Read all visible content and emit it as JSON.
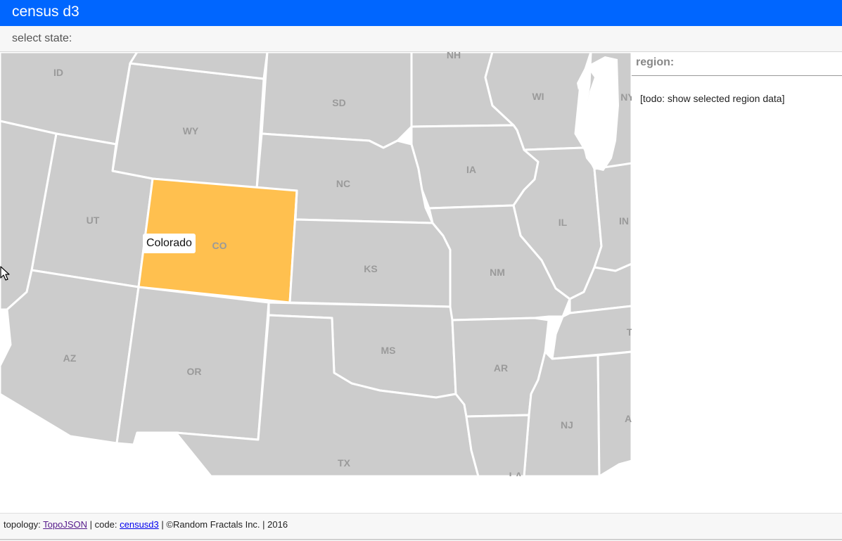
{
  "header": {
    "title": "census d3"
  },
  "toolbar": {
    "select_label": "select state:"
  },
  "map": {
    "selected_state": "CO",
    "selected_fill": "#ffc04f",
    "state_fill": "#cccccc",
    "tooltip": "Colorado",
    "state_labels": [
      "ID",
      "WY",
      "SD",
      "NH",
      "WI",
      "NY",
      "UT",
      "CO",
      "NC",
      "IA",
      "IL",
      "IN",
      "KS",
      "NM",
      "AZ",
      "OR",
      "MS",
      "AR",
      "T",
      "NJ",
      "A",
      "TX",
      "LA"
    ]
  },
  "panel": {
    "title": "region:",
    "placeholder": "[todo: show selected region data]"
  },
  "footer": {
    "topology_label": "topology:",
    "topology_link": "TopoJSON",
    "sep1": "|",
    "code_label": "code:",
    "code_link": "censusd3",
    "sep2": "|",
    "copyright": "©Random Fractals Inc.",
    "sep3": "|",
    "year": "2016"
  },
  "colors": {
    "header_bg": "#0066ff"
  }
}
